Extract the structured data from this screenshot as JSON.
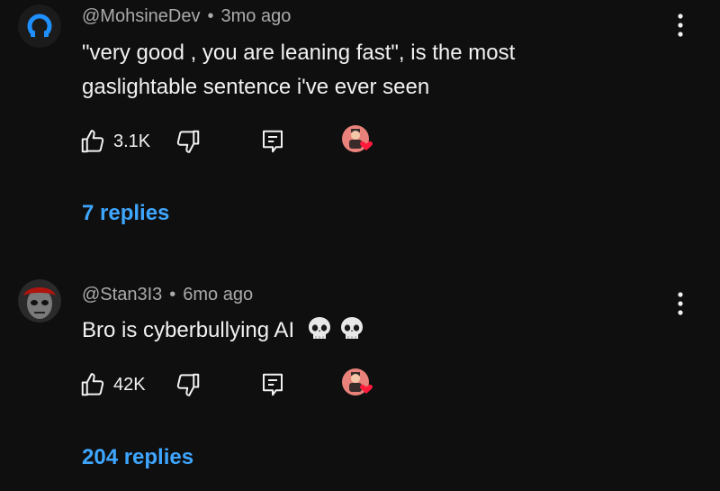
{
  "comments": [
    {
      "handle": "@MohsineDev",
      "separator": "•",
      "time": "3mo ago",
      "text_line1": "\"very good , you are leaning fast\", is the most",
      "text_line2": "gaslightable sentence i've ever seen",
      "likes": "3.1K",
      "replies": "7 replies",
      "avatar_icon": "blue-ring-logo-icon",
      "accent": "#1e90ff"
    },
    {
      "handle": "@Stan3I3",
      "separator": "•",
      "time": "6mo ago",
      "text": "Bro is cyberbullying AI",
      "emoji": [
        "skull",
        "skull"
      ],
      "likes": "42K",
      "replies": "204 replies",
      "avatar_icon": "masked-face-avatar"
    }
  ],
  "colors": {
    "background": "#0f0f0f",
    "text": "#f1f1f1",
    "secondary": "#aaaaaa",
    "link": "#3ea6ff",
    "heart": "#ff1a3c"
  }
}
